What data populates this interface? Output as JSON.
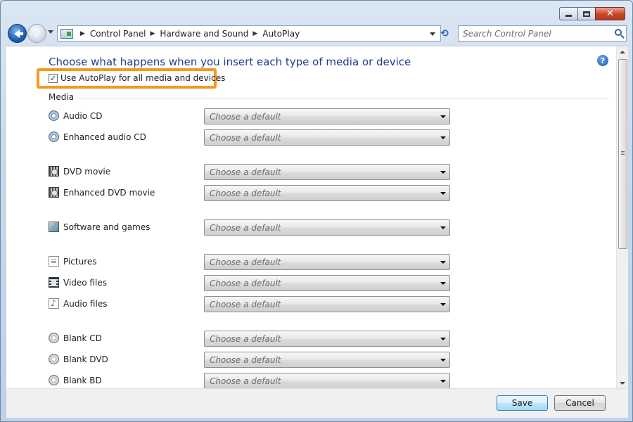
{
  "window": {
    "minimize_label": "",
    "maximize_label": "",
    "close_glyph": "✕"
  },
  "nav": {
    "back_icon": "back-arrow-icon",
    "forward_icon": "forward-arrow-icon",
    "breadcrumbs": [
      "Control Panel",
      "Hardware and Sound",
      "AutoPlay"
    ],
    "search_placeholder": "Search Control Panel"
  },
  "main": {
    "title": "Choose what happens when you insert each type of media or device",
    "autoplay_checkbox_label": "Use AutoPlay for all media and devices",
    "autoplay_checked": true,
    "section_label": "Media",
    "dropdown_placeholder": "Choose a default",
    "items": [
      {
        "label": "Audio CD",
        "icon": "audio-cd-icon"
      },
      {
        "label": "Enhanced audio CD",
        "icon": "enhanced-audio-cd-icon"
      },
      {
        "label": "DVD movie",
        "icon": "dvd-movie-icon"
      },
      {
        "label": "Enhanced DVD movie",
        "icon": "enhanced-dvd-movie-icon"
      },
      {
        "label": "Software and games",
        "icon": "software-games-icon"
      },
      {
        "label": "Pictures",
        "icon": "pictures-icon"
      },
      {
        "label": "Video files",
        "icon": "video-files-icon"
      },
      {
        "label": "Audio files",
        "icon": "audio-files-icon"
      },
      {
        "label": "Blank CD",
        "icon": "blank-cd-icon"
      },
      {
        "label": "Blank DVD",
        "icon": "blank-dvd-icon"
      },
      {
        "label": "Blank BD",
        "icon": "blank-bd-icon"
      }
    ]
  },
  "footer": {
    "save_label": "Save",
    "cancel_label": "Cancel"
  },
  "colors": {
    "highlight": "#f39a1d",
    "title": "#1e3d8f"
  }
}
